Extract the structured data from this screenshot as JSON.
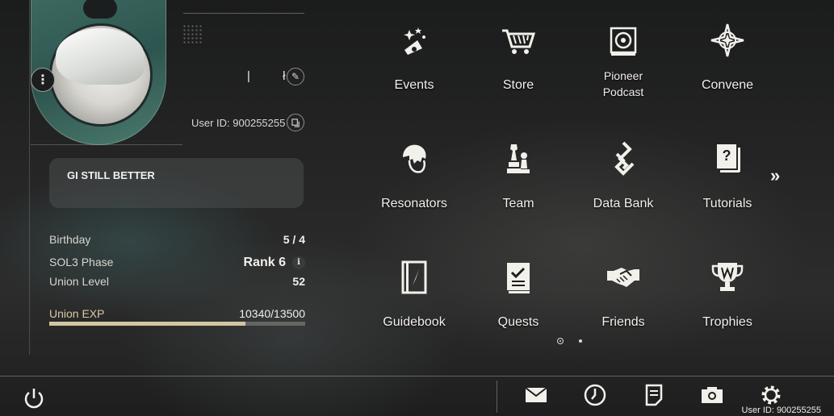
{
  "profile": {
    "name": "| ł",
    "user_id_label": "User ID: 900255255",
    "signature": "GI STILL BETTER",
    "stats": [
      {
        "label": "Birthday",
        "value": "5 / 4"
      },
      {
        "label": "SOL3 Phase",
        "value": "Rank 6"
      },
      {
        "label": "Union Level",
        "value": "52"
      }
    ],
    "exp": {
      "label": "Union EXP",
      "value": "10340/13500",
      "fraction": 0.766
    }
  },
  "menu": [
    {
      "label": "Events",
      "icon": "events-icon"
    },
    {
      "label": "Store",
      "icon": "store-cart-icon"
    },
    {
      "label": "Pioneer\nPodcast",
      "icon": "podcast-icon"
    },
    {
      "label": "Convene",
      "icon": "convene-star-icon"
    },
    {
      "label": "Resonators",
      "icon": "resonator-head-icon"
    },
    {
      "label": "Team",
      "icon": "team-chess-icon"
    },
    {
      "label": "Data Bank",
      "icon": "data-bank-icon"
    },
    {
      "label": "Tutorials",
      "icon": "tutorial-book-icon"
    },
    {
      "label": "Guidebook",
      "icon": "guidebook-icon"
    },
    {
      "label": "Quests",
      "icon": "quests-checklist-icon"
    },
    {
      "label": "Friends",
      "icon": "handshake-icon"
    },
    {
      "label": "Trophies",
      "icon": "trophy-icon"
    }
  ],
  "bottom_bar": {
    "icons": [
      "power-icon",
      "mail-icon",
      "clock-icon",
      "notice-icon",
      "camera-icon",
      "settings-gear-icon"
    ],
    "user_id_label": "User ID: 900255255"
  },
  "pagination": {
    "pages": 2,
    "current": 1
  },
  "colors": {
    "accent": "#d3c6a2",
    "text": "#f2f0eb",
    "panel": "#4b4e4e"
  }
}
